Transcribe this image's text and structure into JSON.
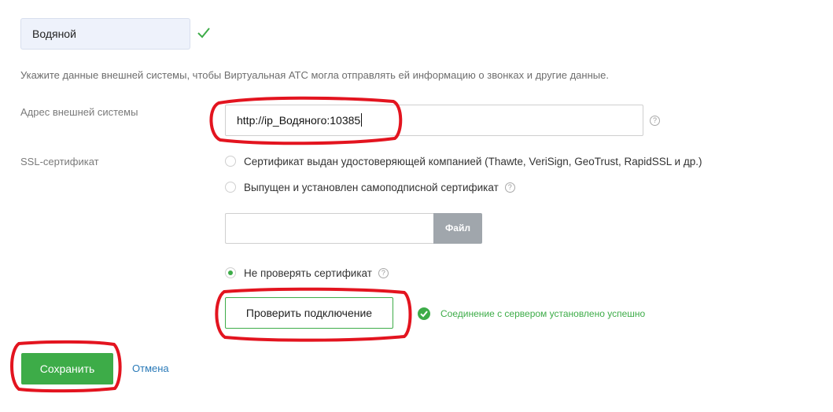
{
  "name_field": {
    "value": "Водяной"
  },
  "hint_text": "Укажите данные внешней системы, чтобы Виртуальная АТС могла отправлять ей информацию о звонках и другие данные.",
  "address": {
    "label": "Адрес внешней системы",
    "value": "http://ip_Водяного:10385"
  },
  "ssl": {
    "label": "SSL-сертификат",
    "options": [
      {
        "label": "Сертификат выдан удостоверяющей компанией (Thawte, VeriSign, GeoTrust, RapidSSL и др.)",
        "checked": false
      },
      {
        "label": "Выпущен и установлен самоподписной сертификат",
        "checked": false
      },
      {
        "label": "Не проверять сертификат",
        "checked": true
      }
    ],
    "file_button_label": "Файл",
    "file_value": ""
  },
  "help_glyph": "?",
  "check_connection": {
    "button_label": "Проверить подключение",
    "status_text": "Соединение с сервером установлено успешно"
  },
  "actions": {
    "save_label": "Сохранить",
    "cancel_label": "Отмена"
  },
  "colors": {
    "accent_green": "#3dac48",
    "annotation_red": "#e3141f",
    "link_blue": "#2a7ab8",
    "file_button_gray": "#a0a6ac"
  }
}
